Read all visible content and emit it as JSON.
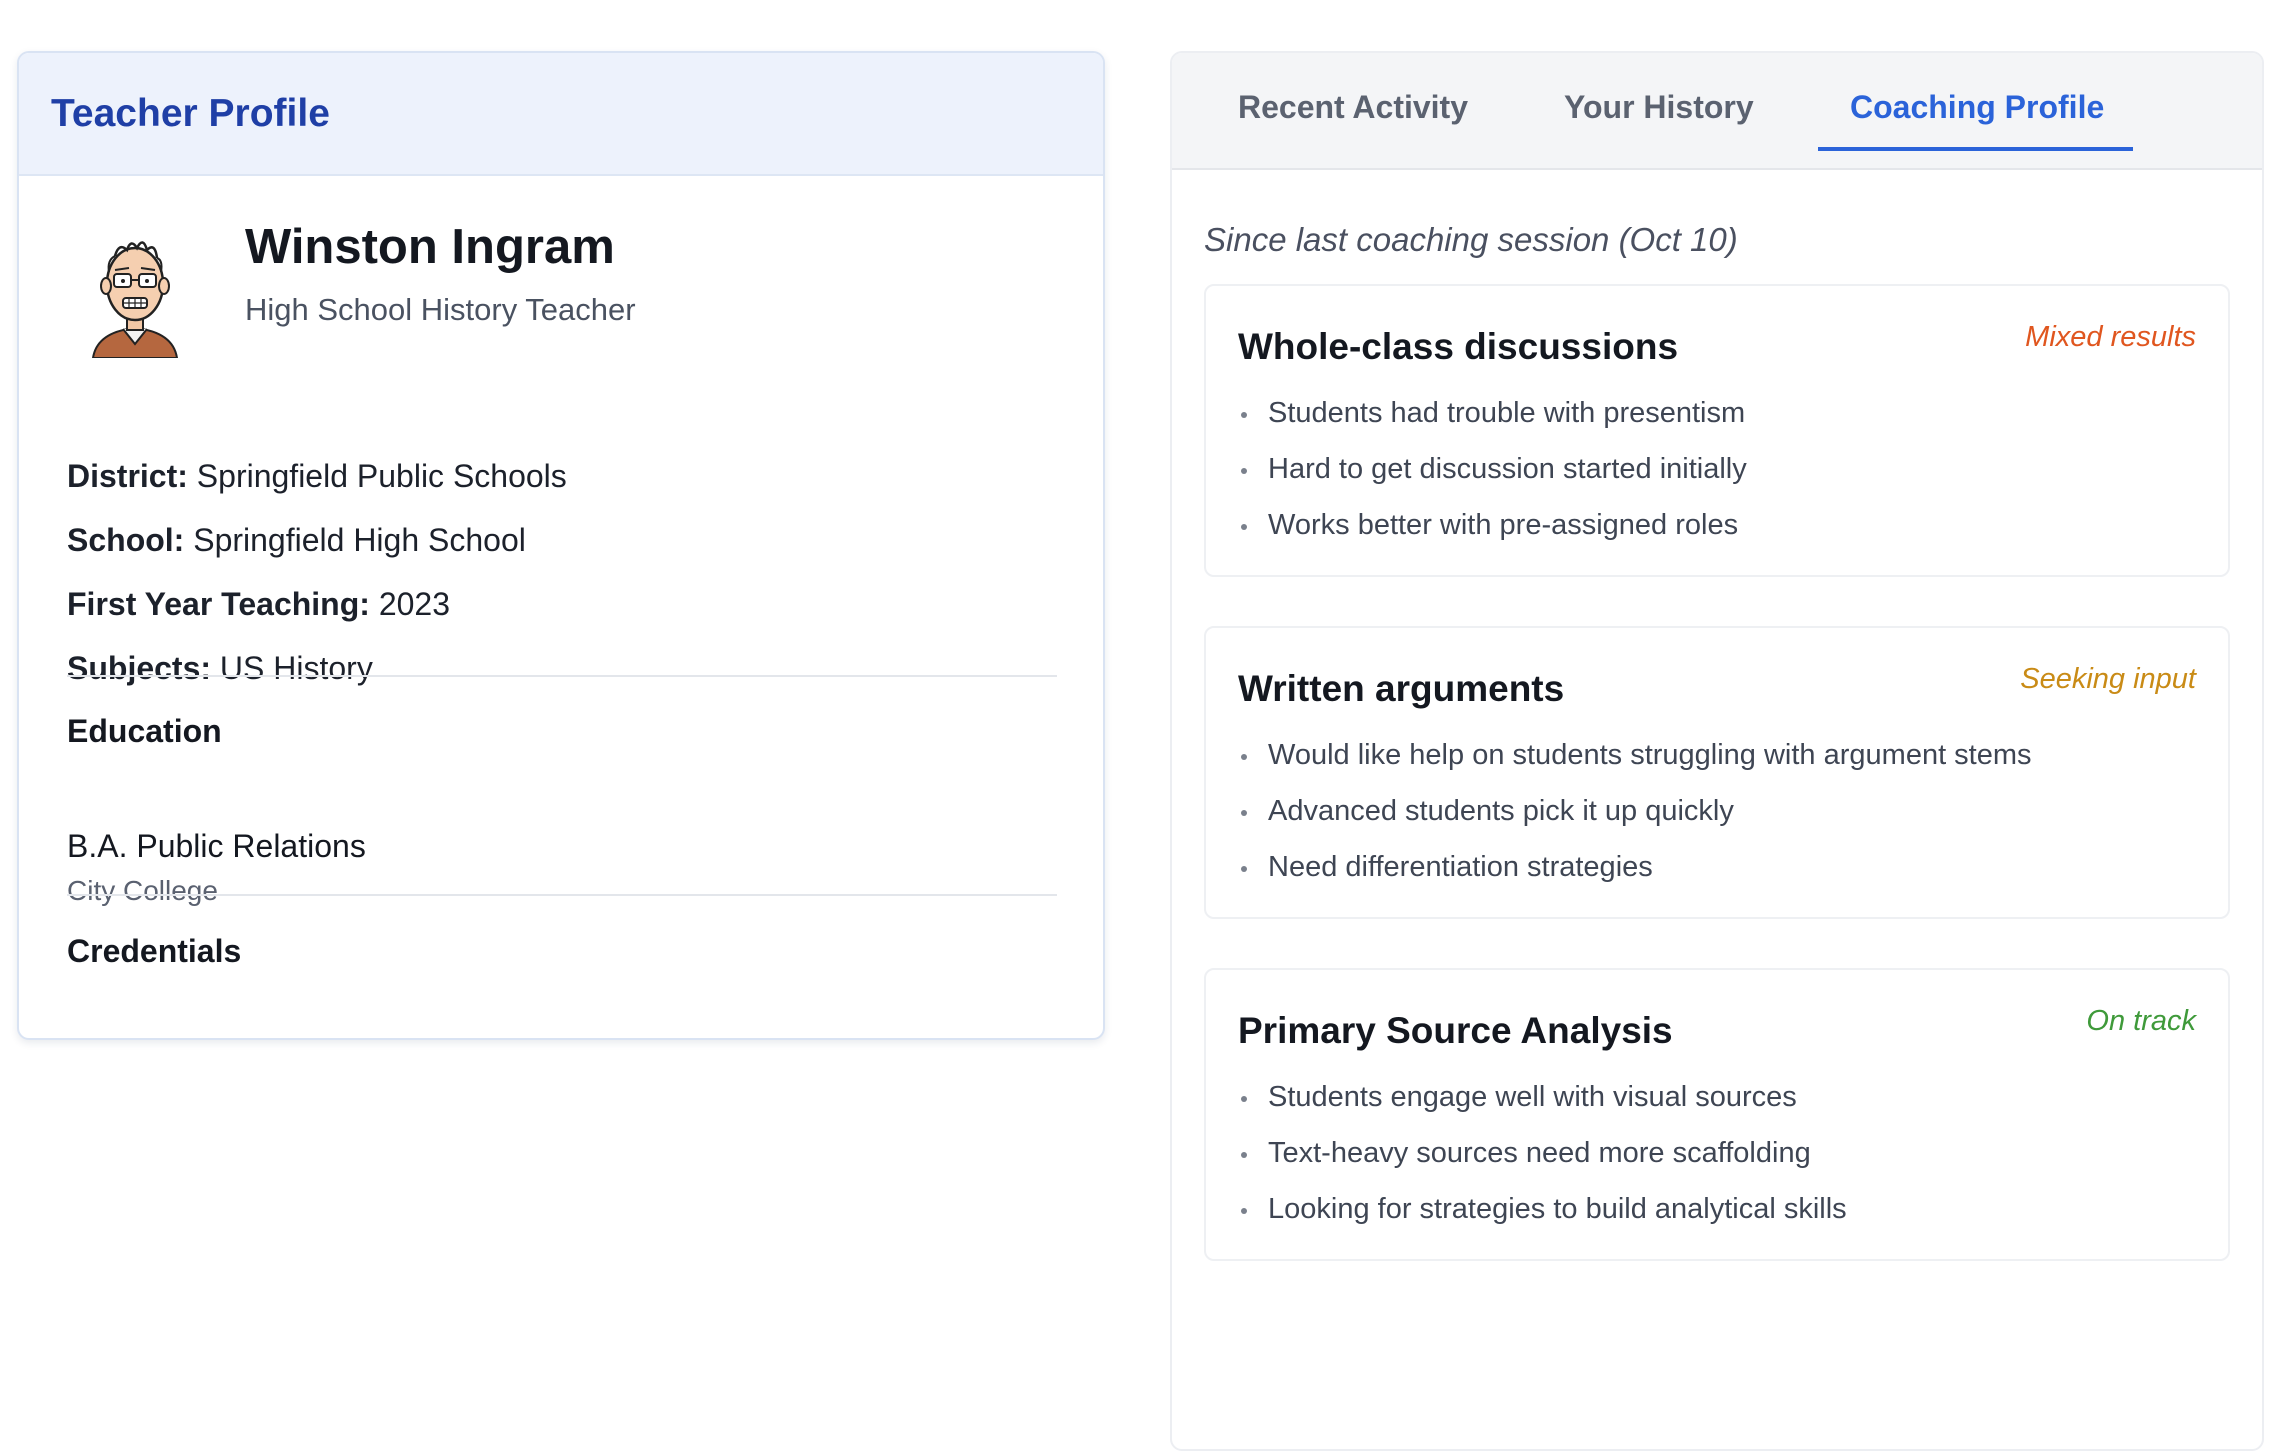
{
  "profile": {
    "header_title": "Teacher Profile",
    "name": "Winston Ingram",
    "role": "High School History Teacher",
    "facts": [
      {
        "label": "District:",
        "value": "Springfield Public Schools"
      },
      {
        "label": "School:",
        "value": "Springfield High School"
      },
      {
        "label": "First Year Teaching:",
        "value": "2023"
      },
      {
        "label": "Subjects:",
        "value": "US History"
      }
    ],
    "education": {
      "title": "Education",
      "degree": "B.A. Public Relations",
      "institution": "City College"
    },
    "credentials": {
      "title": "Credentials"
    }
  },
  "coaching": {
    "tabs": [
      {
        "label": "Recent Activity",
        "active": false
      },
      {
        "label": "Your History",
        "active": false
      },
      {
        "label": "Coaching Profile",
        "active": true
      }
    ],
    "since_label": "Since last coaching session (Oct 10)",
    "areas": [
      {
        "title": "Whole-class discussions",
        "status": "Mixed results",
        "status_color": "#e0561f",
        "notes": [
          "Students had trouble with presentism",
          "Hard to get discussion started initially",
          "Works better with pre-assigned roles"
        ]
      },
      {
        "title": "Written arguments",
        "status": "Seeking input",
        "status_color": "#c98b16",
        "notes": [
          "Would like help on students struggling with argument stems",
          "Advanced students pick it up quickly",
          "Need differentiation strategies"
        ]
      },
      {
        "title": "Primary Source Analysis",
        "status": "On track",
        "status_color": "#3f9a3a",
        "notes": [
          "Students engage well with visual sources",
          "Text-heavy sources need more scaffolding",
          "Looking for strategies to build analytical skills"
        ]
      }
    ]
  },
  "colors": {
    "accent": "#2b63d9",
    "header_title": "#1f3fa6",
    "header_bg": "#edf2fc"
  },
  "icons": {
    "avatar": "cartoon-teacher-avatar"
  }
}
